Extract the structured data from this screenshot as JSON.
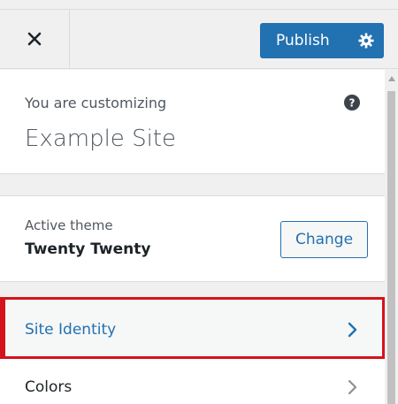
{
  "header": {
    "close_icon": "close-icon",
    "publish_label": "Publish",
    "settings_icon": "gear-icon",
    "accent_color": "#2271b1"
  },
  "info": {
    "customizing_label": "You are customizing",
    "site_name": "Example Site",
    "help_icon": "question-circle-icon"
  },
  "theme": {
    "active_theme_label": "Active theme",
    "theme_name": "Twenty Twenty",
    "change_label": "Change"
  },
  "menu": {
    "items": [
      {
        "label": "Site Identity",
        "highlighted": true,
        "highlight_color": "#d4131a"
      },
      {
        "label": "Colors",
        "highlighted": false
      }
    ]
  }
}
